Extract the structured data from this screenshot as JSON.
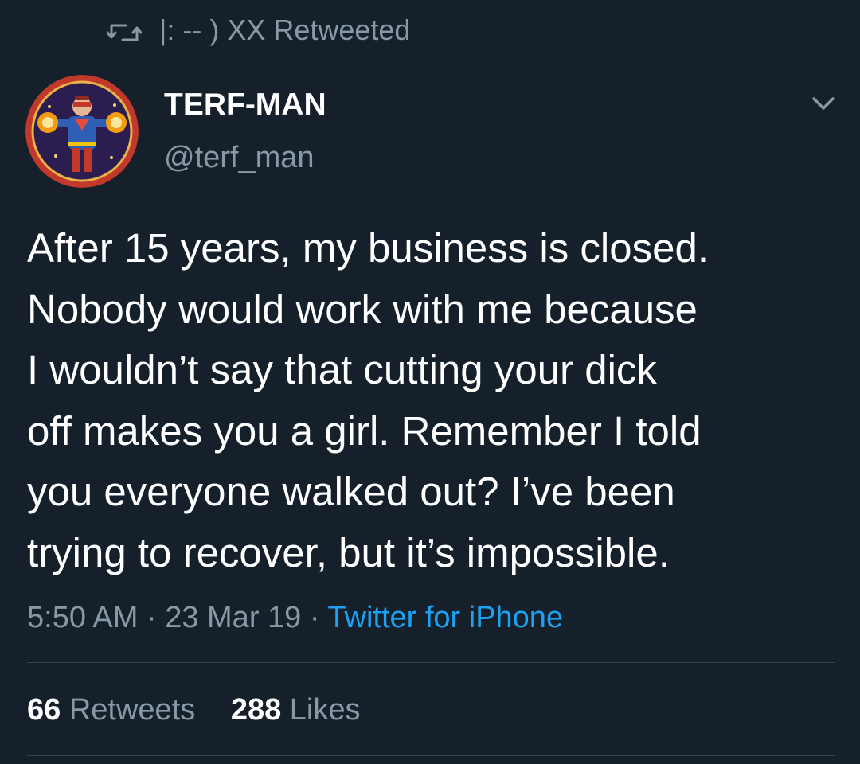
{
  "retweet_header": {
    "icon": "retweet-icon",
    "text": "|: -- ) XX Retweeted"
  },
  "author": {
    "display_name": "TERF-MAN",
    "handle": "@terf_man",
    "avatar": "superhero-avatar",
    "menu_icon": "chevron-down-icon"
  },
  "tweet": {
    "text": "After 15 years, my business is closed.\nNobody would work with me because\nI wouldn’t say that cutting your dick\noff makes you a girl. Remember I told\nyou everyone walked out? I’ve been\ntrying to recover, but it’s impossible.",
    "time": "5:50 AM",
    "separator": " · ",
    "date": "23 Mar 19",
    "source": "Twitter for iPhone"
  },
  "stats": {
    "retweets_count": "66",
    "retweets_label": "Retweets",
    "likes_count": "288",
    "likes_label": "Likes"
  },
  "colors": {
    "background": "#15202b",
    "secondary_text": "#8899a6",
    "link": "#1da1f2",
    "divider": "#38444d"
  }
}
